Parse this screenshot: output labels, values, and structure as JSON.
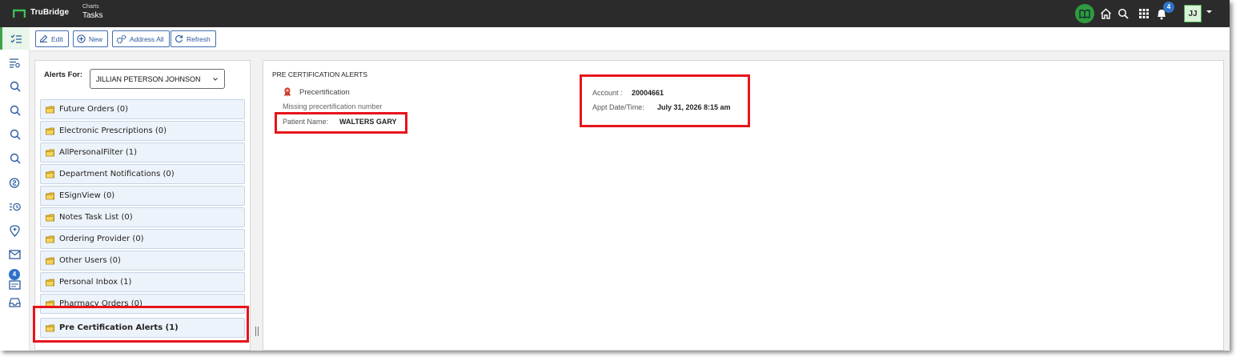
{
  "header": {
    "brand": "TruBridge",
    "breadcrumb_parent": "Charts",
    "breadcrumb_current": "Tasks",
    "notification_count": "4",
    "user_initials": "JJ",
    "icons": [
      "book-icon",
      "home-icon",
      "search-icon",
      "apps-grid-icon",
      "bell-icon",
      "chevron-down-icon"
    ],
    "accent_color": "#2e9b3e"
  },
  "leftnav": {
    "icons": [
      "tasks-icon",
      "filter-list-icon",
      "search-icon",
      "search-icon",
      "search-icon",
      "search-icon",
      "clock-dollar-icon",
      "history-list-icon",
      "location-pin-icon",
      "mail-icon",
      "inbox-badge-icon",
      "inbox-tray-icon"
    ],
    "badge": "4"
  },
  "toolbar": {
    "edit_label": "Edit",
    "new_label": "New",
    "address_all_label": "Address All",
    "refresh_label": "Refresh"
  },
  "left_panel": {
    "alerts_for_label": "Alerts For:",
    "alerts_for_value": "JILLIAN PETERSON JOHNSON",
    "folders": [
      {
        "label": "Future Orders (0)"
      },
      {
        "label": "Electronic Prescriptions (0)"
      },
      {
        "label": "AllPersonalFilter (1)"
      },
      {
        "label": "Department Notifications (0)"
      },
      {
        "label": "ESignView (0)"
      },
      {
        "label": "Notes Task List (0)"
      },
      {
        "label": "Ordering Provider (0)"
      },
      {
        "label": "Other Users (0)"
      },
      {
        "label": "Personal Inbox (1)"
      },
      {
        "label": "Pharmacy Orders (0)"
      },
      {
        "label": "Pre Certification Alerts (1)"
      }
    ],
    "selected_folder": "Pre Certification Alerts (1)"
  },
  "detail": {
    "section_title": "PRE CERTIFICATION ALERTS",
    "alert_title": "Precertification",
    "alert_message": "Missing precertification number",
    "patient_label": "Patient Name:",
    "patient_value": "WALTERS GARY",
    "account_label": "Account :",
    "account_value": "20004661",
    "appt_label": "Appt Date/Time:",
    "appt_value": "July 31, 2026 8:15 am"
  },
  "colors": {
    "topbar": "#2b2b2b",
    "button_border": "#3f6fb1",
    "highlight": "#e8141b",
    "folder_bg": "#edf3fa"
  }
}
